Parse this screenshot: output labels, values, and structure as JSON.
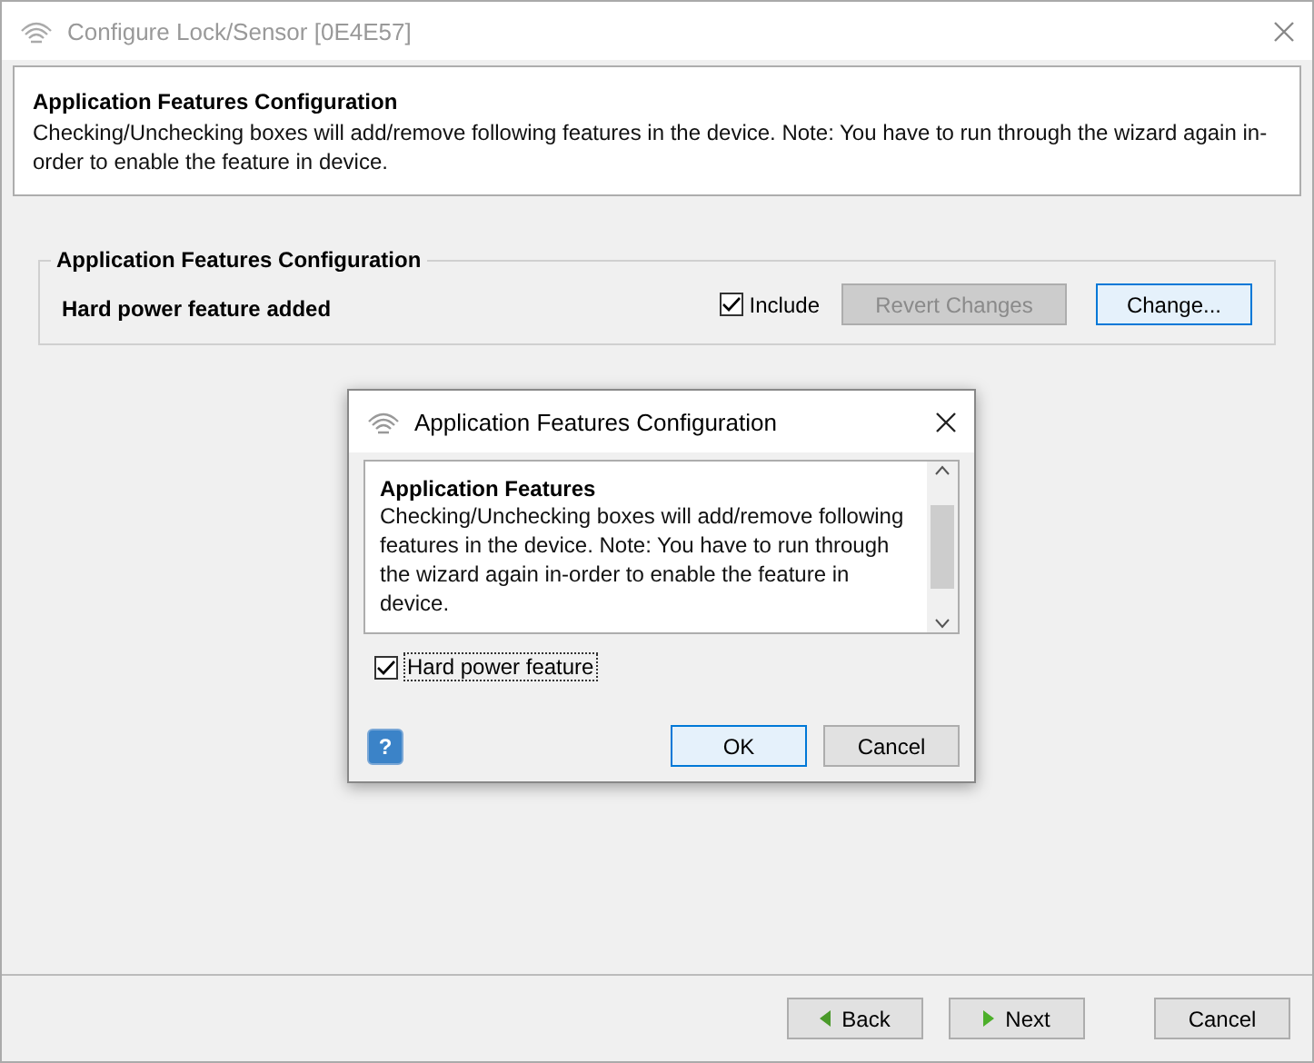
{
  "window": {
    "title": "Configure Lock/Sensor [0E4E57]"
  },
  "header": {
    "title": "Application Features Configuration",
    "description": "Checking/Unchecking boxes will add/remove following features in the device. Note: You have to run through the wizard again in-order to enable the feature in device."
  },
  "group": {
    "title": "Application Features Configuration",
    "feature_label": "Hard power feature added",
    "include": {
      "label": "Include",
      "checked": true
    },
    "revert_button": {
      "label": "Revert Changes",
      "disabled": true
    },
    "change_button": {
      "label": "Change..."
    }
  },
  "dialog": {
    "title": "Application Features Configuration",
    "info_title": "Application Features",
    "info_text": "Checking/Unchecking boxes will add/remove following features in the device. Note: You have to run through the wizard again in-order to enable the feature in device.",
    "feature": {
      "label": "Hard power feature",
      "checked": true
    },
    "help": "?",
    "ok": "OK",
    "cancel": "Cancel"
  },
  "footer": {
    "back": "Back",
    "next": "Next",
    "cancel": "Cancel"
  }
}
